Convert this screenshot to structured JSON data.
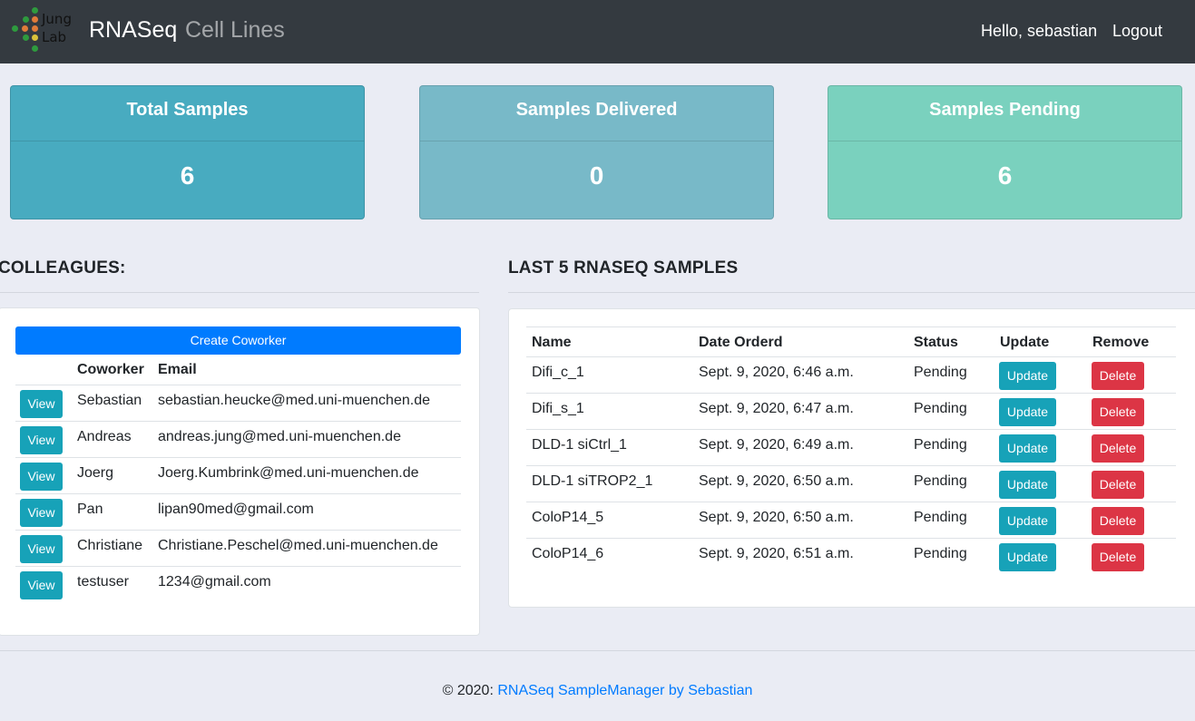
{
  "navbar": {
    "logo_line1": "Jung",
    "logo_line2": "Lab",
    "brand": "RNASeq",
    "section": "Cell Lines",
    "greeting": "Hello, sebastian",
    "logout": "Logout"
  },
  "stats": [
    {
      "title": "Total Samples",
      "value": "6",
      "color": "#48abc0"
    },
    {
      "title": "Samples Delivered",
      "value": "0",
      "color": "#78b9c8"
    },
    {
      "title": "Samples Pending",
      "value": "6",
      "color": "#7ad1be"
    }
  ],
  "colleagues": {
    "heading": "COLLEAGUES:",
    "create_label": "Create Coworker",
    "col_coworker": "Coworker",
    "col_email": "Email",
    "view_label": "View",
    "rows": [
      {
        "name": "Sebastian",
        "email": "sebastian.heucke@med.uni-muenchen.de"
      },
      {
        "name": "Andreas",
        "email": "andreas.jung@med.uni-muenchen.de"
      },
      {
        "name": "Joerg",
        "email": "Joerg.Kumbrink@med.uni-muenchen.de"
      },
      {
        "name": "Pan",
        "email": "lipan90med@gmail.com"
      },
      {
        "name": "Christiane",
        "email": "Christiane.Peschel@med.uni-muenchen.de"
      },
      {
        "name": "testuser",
        "email": "1234@gmail.com"
      }
    ]
  },
  "samples": {
    "heading": "LAST 5 RNASEQ SAMPLES",
    "col_name": "Name",
    "col_date": "Date Orderd",
    "col_status": "Status",
    "col_update": "Update",
    "col_remove": "Remove",
    "update_label": "Update",
    "delete_label": "Delete",
    "rows": [
      {
        "name": "Difi_c_1",
        "date": "Sept. 9, 2020, 6:46 a.m.",
        "status": "Pending"
      },
      {
        "name": "Difi_s_1",
        "date": "Sept. 9, 2020, 6:47 a.m.",
        "status": "Pending"
      },
      {
        "name": "DLD-1 siCtrl_1",
        "date": "Sept. 9, 2020, 6:49 a.m.",
        "status": "Pending"
      },
      {
        "name": "DLD-1 siTROP2_1",
        "date": "Sept. 9, 2020, 6:50 a.m.",
        "status": "Pending"
      },
      {
        "name": "ColoP14_5",
        "date": "Sept. 9, 2020, 6:50 a.m.",
        "status": "Pending"
      },
      {
        "name": "ColoP14_6",
        "date": "Sept. 9, 2020, 6:51 a.m.",
        "status": "Pending"
      }
    ]
  },
  "footer": {
    "prefix": "© 2020: ",
    "link": "RNASeq SampleManager by Sebastian"
  }
}
